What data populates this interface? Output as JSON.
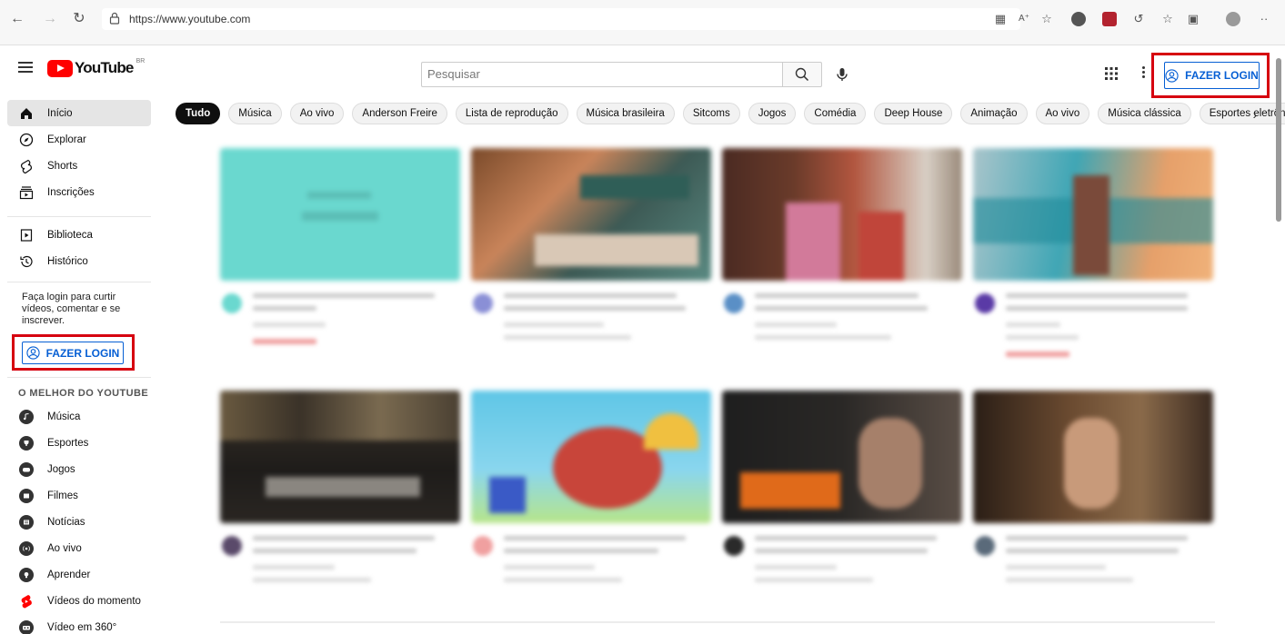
{
  "browser": {
    "url": "https://www.youtube.com"
  },
  "header": {
    "logo_text": "YouTube",
    "region": "BR",
    "search_placeholder": "Pesquisar",
    "login_label": "FAZER LOGIN"
  },
  "chips": [
    "Tudo",
    "Música",
    "Ao vivo",
    "Anderson Freire",
    "Lista de reprodução",
    "Música brasileira",
    "Sitcoms",
    "Jogos",
    "Comédia",
    "Deep House",
    "Animação",
    "Ao vivo",
    "Música clássica",
    "Esportes eletrônicos"
  ],
  "sidebar": {
    "main": [
      {
        "label": "Início",
        "icon": "home-icon"
      },
      {
        "label": "Explorar",
        "icon": "compass-icon"
      },
      {
        "label": "Shorts",
        "icon": "shorts-icon"
      },
      {
        "label": "Inscrições",
        "icon": "subscriptions-icon"
      }
    ],
    "library": [
      {
        "label": "Biblioteca",
        "icon": "library-icon"
      },
      {
        "label": "Histórico",
        "icon": "history-icon"
      }
    ],
    "login_prompt": "Faça login para curtir vídeos, comentar e se inscrever.",
    "login_label": "FAZER LOGIN",
    "best_heading": "O MELHOR DO YOUTUBE",
    "best": [
      {
        "label": "Música",
        "icon": "music-icon"
      },
      {
        "label": "Esportes",
        "icon": "trophy-icon"
      },
      {
        "label": "Jogos",
        "icon": "gamepad-icon"
      },
      {
        "label": "Filmes",
        "icon": "film-icon"
      },
      {
        "label": "Notícias",
        "icon": "news-icon"
      },
      {
        "label": "Ao vivo",
        "icon": "live-icon"
      },
      {
        "label": "Aprender",
        "icon": "bulb-icon"
      },
      {
        "label": "Vídeos do momento",
        "icon": "shorts-trending-icon"
      },
      {
        "label": "Vídeo em 360°",
        "icon": "vr-icon"
      }
    ]
  },
  "colors": {
    "brand": "#ff0000",
    "link_blue": "#065fd4",
    "highlight_red": "#d6000f"
  }
}
